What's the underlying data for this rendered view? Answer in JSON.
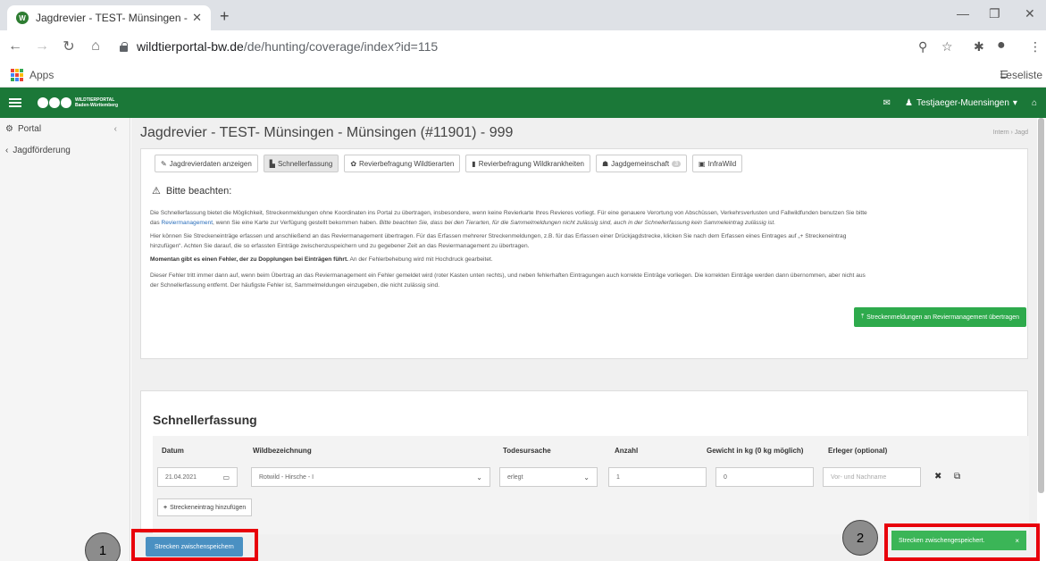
{
  "browser": {
    "tab_title": "Jagdrevier - TEST- Münsingen - M",
    "url_domain": "wildtierportal-bw.de",
    "url_path": "/de/hunting/coverage/index?id=115",
    "bookmarks_apps": "Apps",
    "reading_list": "Leseliste"
  },
  "appbar": {
    "logo_text_line1": "WILDTIERPORTAL",
    "logo_text_line2": "Baden-Württemberg",
    "user": "Testjaeger-Muensingen"
  },
  "sidebar": {
    "items": [
      {
        "label": "Portal"
      },
      {
        "label": "Jagdförderung"
      }
    ]
  },
  "page": {
    "title": "Jagdrevier - TEST- Münsingen - Münsingen (#11901) - 999",
    "breadcrumb": "Intern › Jagd"
  },
  "tabs": [
    {
      "label": "Jagdrevierdaten anzeigen",
      "icon": "pencil-icon"
    },
    {
      "label": "Schnellerfassung",
      "icon": "chart-icon"
    },
    {
      "label": "Revierbefragung Wildtierarten",
      "icon": "paw-icon"
    },
    {
      "label": "Revierbefragung Wildkrankheiten",
      "icon": "book-icon"
    },
    {
      "label": "Jagdgemeinschaft",
      "badge": "3",
      "icon": "group-icon"
    },
    {
      "label": "InfraWild",
      "icon": "image-icon"
    }
  ],
  "notice": {
    "title": "Bitte beachten:",
    "p1a": "Die Schnellerfassung bietet die Möglichkeit, Streckenmeldungen ohne Koordinaten ins Portal zu übertragen, insbesondere, wenn keine Revierkarte Ihres Revieres vorliegt. Für eine genauere Verortung von Abschüssen, Verkehrsverlusten und Fallwildfunden benutzen Sie bitte",
    "p1b": "das",
    "p1_link": "Reviermanagement",
    "p1c": ", wenn Sie eine Karte zur Verfügung gestellt bekommen haben.",
    "p1d": "Bitte beachten Sie, dass bei den Tierarten, für die Sammelmeldungen nicht zulässig sind, auch in der Schnellerfassung kein Sammeleintrag zulässig ist.",
    "p2": "Hier können Sie Streckeneinträge erfassen und anschließend an das Reviermanagement übertragen. Für das Erfassen mehrerer Streckenmeldungen, z.B. für das Erfassen einer Drückjagdstrecke, klicken Sie nach dem Erfassen eines Eintrages auf „+ Streckeneintrag",
    "p2b": "hinzufügen“. Achten Sie darauf, die so erfassten Einträge zwischenzuspeichern und zu gegebener Zeit an das Reviermanagement zu übertragen.",
    "p3_bold": "Momentan gibt es einen Fehler, der zu Dopplungen bei Einträgen führt.",
    "p3": "An der Fehlerbehebung wird mit Hochdruck gearbeitet.",
    "p4": "Dieser Fehler tritt immer dann auf, wenn beim Übertrag an das Reviermanagement ein Fehler gemeldet wird (roter Kasten unten rechts), und neben fehlerhaften Eintragungen auch korrekte Einträge vorliegen. Die korrekten Einträge werden dann übernommen, aber nicht aus",
    "p4b": "der Schnellerfassung entfernt. Der häufigste Fehler ist, Sammelmeldungen einzugeben, die nicht zulässig sind."
  },
  "transfer_button": "Streckenmeldungen an Reviermanagement übertragen",
  "quick": {
    "title": "Schnellerfassung",
    "headers": {
      "datum": "Datum",
      "wild": "Wildbezeichnung",
      "todesursache": "Todesursache",
      "anzahl": "Anzahl",
      "gewicht": "Gewicht in kg (0 kg möglich)",
      "erleger": "Erleger (optional)"
    },
    "row": {
      "datum": "21.04.2021",
      "wild": "Rotwild - Hirsche - I",
      "todesursache": "erlegt",
      "anzahl": "1",
      "gewicht": "0",
      "erleger_placeholder": "Vor- und Nachname"
    },
    "add_label": "Streckeneintrag hinzufügen"
  },
  "save_button": "Strecken zwischenspeichern",
  "toast": "Strecken zwischengespeichert.",
  "markers": [
    "1",
    "2"
  ],
  "colors": {
    "brand_green": "#1b7838",
    "success": "#3bb557",
    "primary": "#4a90c2",
    "highlight": "#e8000b"
  }
}
